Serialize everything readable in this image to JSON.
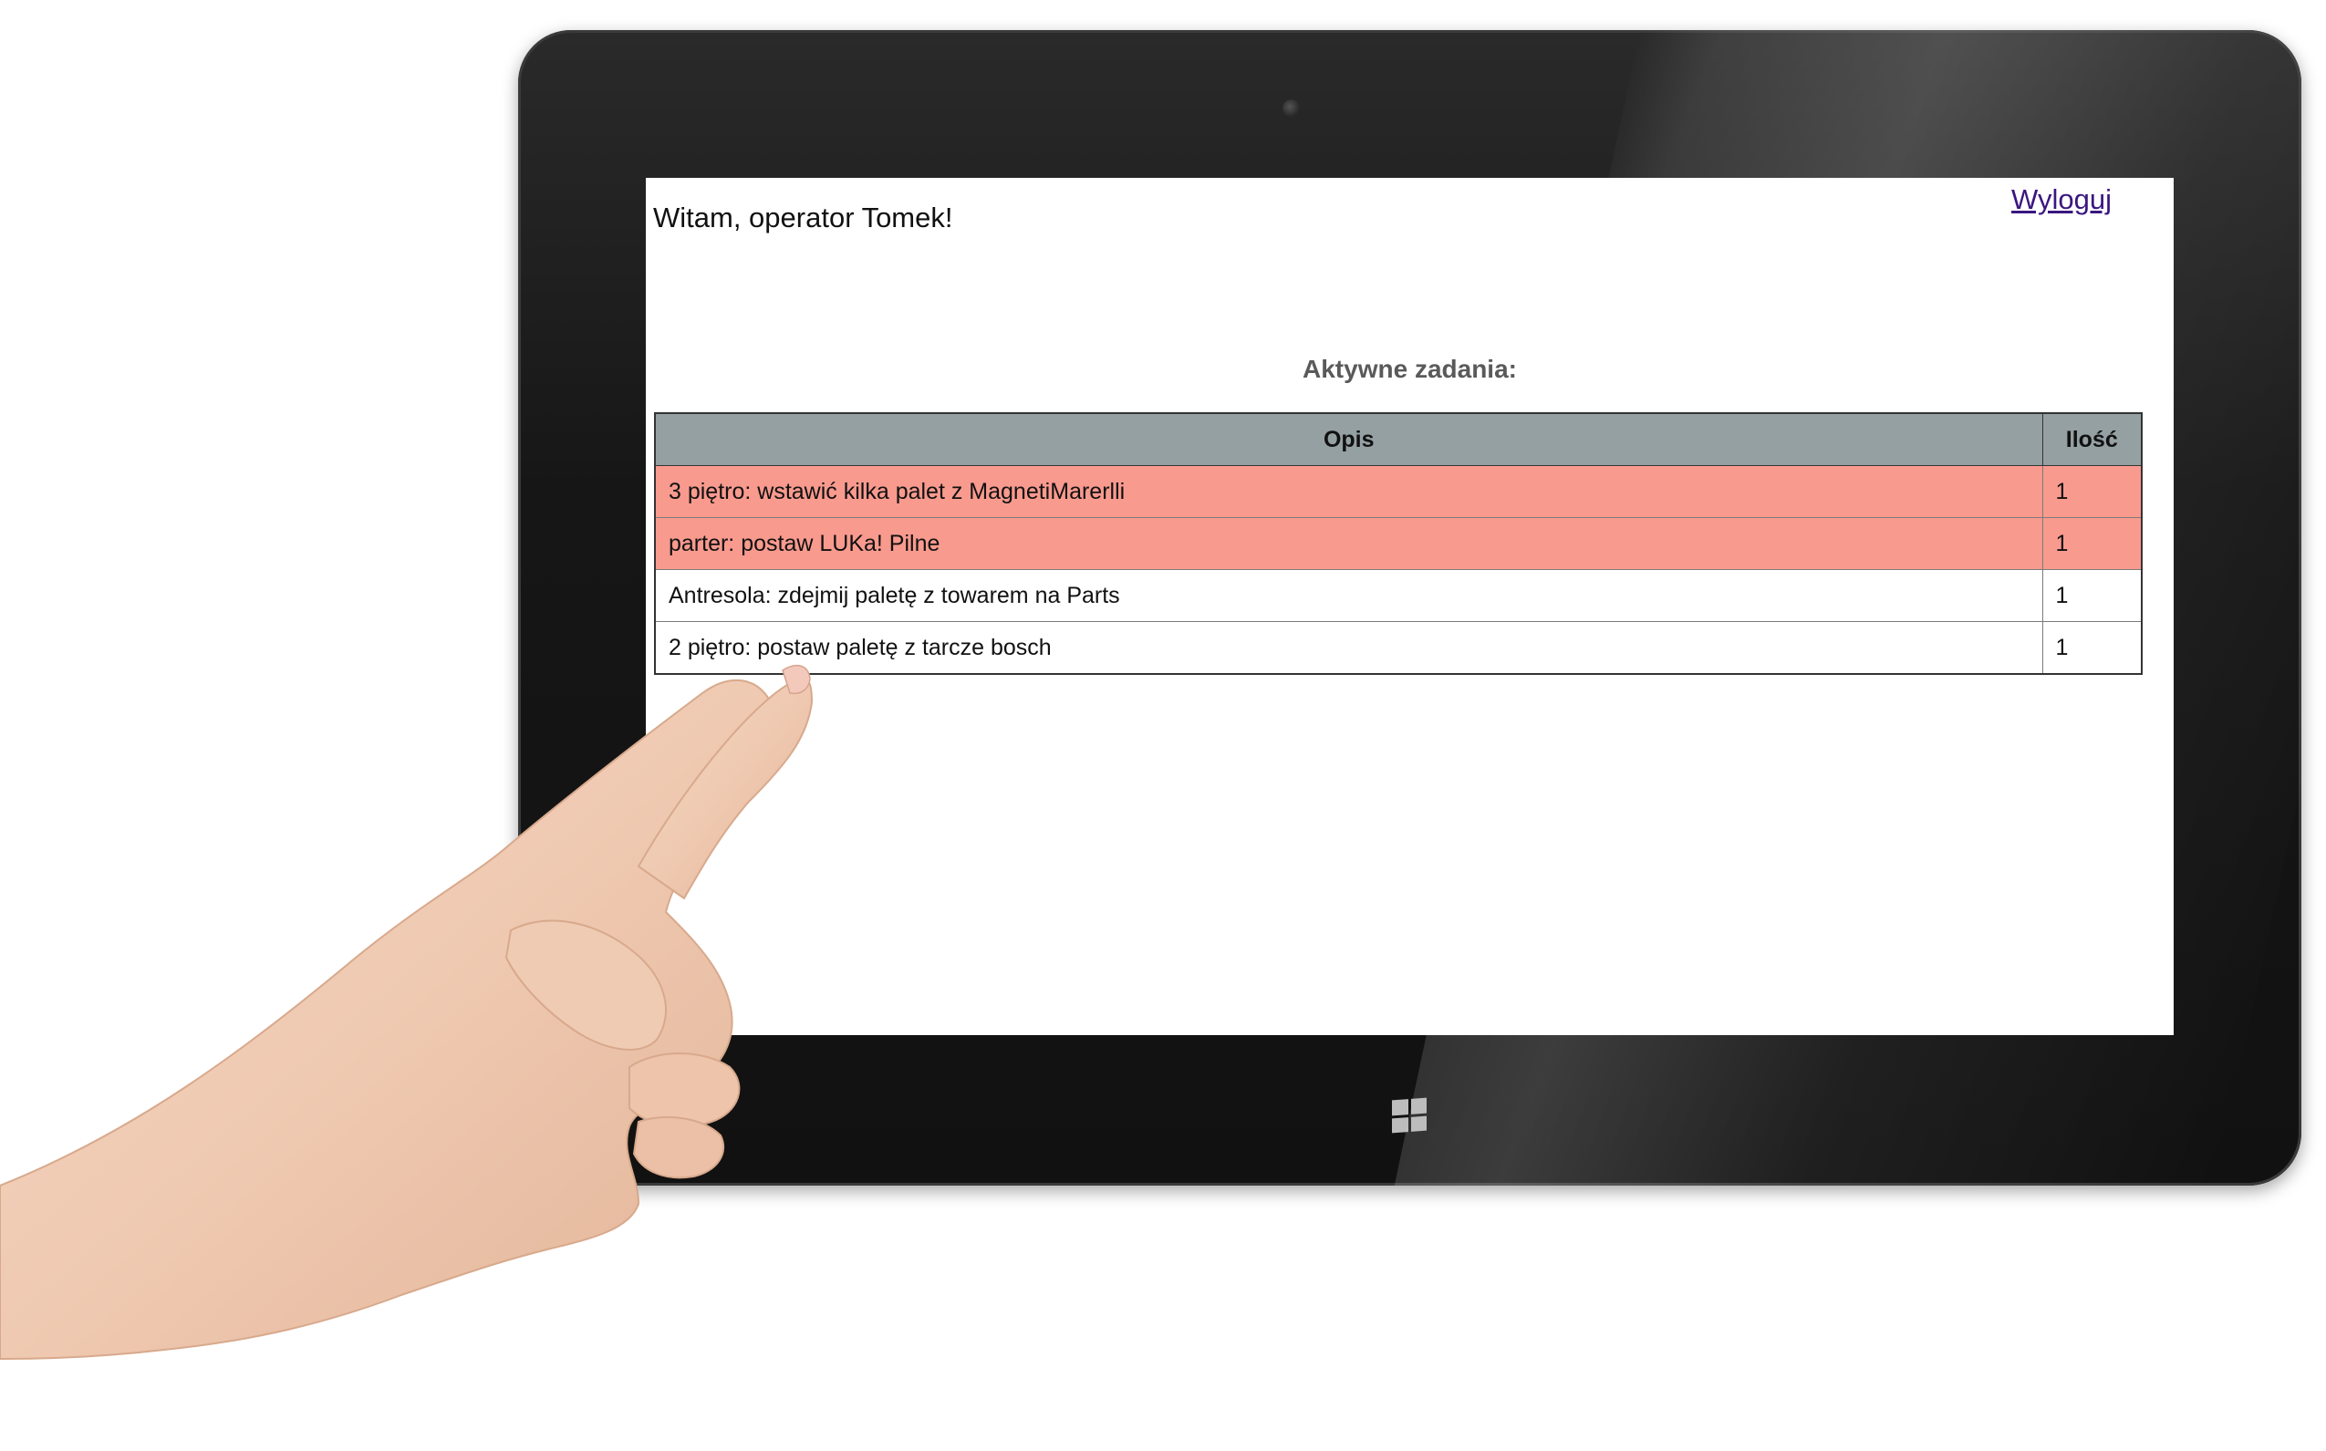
{
  "header": {
    "greeting": "Witam, operator Tomek!",
    "logout_label": "Wyloguj"
  },
  "main": {
    "section_title": "Aktywne zadania:",
    "table": {
      "columns": [
        "Opis",
        "Ilość"
      ],
      "rows": [
        {
          "description": "3 piętro: wstawić kilka palet z MagnetiMarerlli",
          "quantity": "1",
          "highlight": "urgent"
        },
        {
          "description": "parter: postaw LUKa! Pilne",
          "quantity": "1",
          "highlight": "urgent"
        },
        {
          "description": "Antresola: zdejmij paletę z towarem na Parts",
          "quantity": "1",
          "highlight": "normal"
        },
        {
          "description": "2 piętro: postaw paletę z tarcze bosch",
          "quantity": "1",
          "highlight": "normal"
        }
      ]
    }
  },
  "colors": {
    "urgent_row": "#f99a8e",
    "header_row": "#95a0a2",
    "link": "#3b1780",
    "section_title": "#5a5a5a"
  },
  "icons": {
    "start_button": "windows-logo-icon",
    "camera": "front-camera-icon"
  }
}
